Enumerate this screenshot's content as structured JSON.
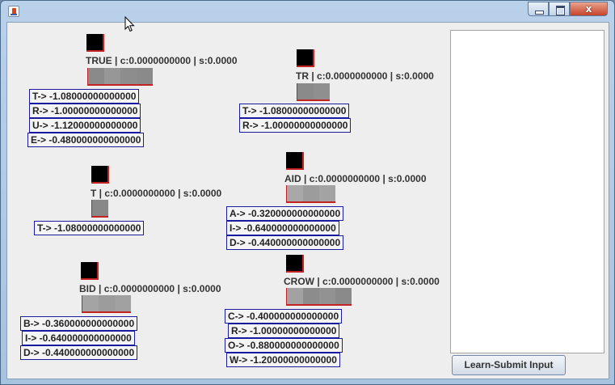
{
  "window": {
    "close_glyph": "x",
    "icon": "java-app-icon"
  },
  "nodes": [
    {
      "id": "TRUE",
      "label": "TRUE | c:0.0000000000 | s:0.0000",
      "bar": [
        "#8a8a8a",
        "#979797",
        "#8d8d8d",
        "#8a8a8a",
        "#b0b0b0"
      ],
      "weights": [
        "T->  -1.08000000000000",
        "R->  -1.00000000000000",
        "U->  -1.12000000000000",
        "E->  -0.480000000000000"
      ]
    },
    {
      "id": "TR",
      "label": "TR | c:0.0000000000 | s:0.0000",
      "bar": [
        "#8a8a8a",
        "#8f8f8f"
      ],
      "weights": [
        "T->  -1.08000000000000",
        "R->  -1.00000000000000"
      ]
    },
    {
      "id": "T",
      "label": "T | c:0.0000000000 | s:0.0000",
      "bar": [
        "#888888"
      ],
      "weights": [
        "T->  -1.08000000000000"
      ]
    },
    {
      "id": "AID",
      "label": "AID | c:0.0000000000 | s:0.0000",
      "bar": [
        "#a8a8a8",
        "#9c9c9c",
        "#a3a3a3"
      ],
      "weights": [
        "A->  -0.320000000000000",
        "I->  -0.640000000000000",
        "D->  -0.440000000000000"
      ]
    },
    {
      "id": "BID",
      "label": "BID | c:0.0000000000 | s:0.0000",
      "bar": [
        "#a4a4a4",
        "#9c9c9c",
        "#a1a1a1"
      ],
      "weights": [
        "B->  -0.360000000000000",
        "I->  -0.640000000000000",
        "D->  -0.440000000000000"
      ]
    },
    {
      "id": "CROW",
      "label": "CROW | c:0.0000000000 | s:0.0000",
      "bar": [
        "#a2a2a2",
        "#8c8c8c",
        "#929292",
        "#8a8a8a"
      ],
      "weights": [
        "C->  -0.400000000000000",
        "R->  -1.00000000000000",
        "O->  -0.880000000000000",
        "W->  -1.20000000000000"
      ]
    }
  ],
  "output_area": {
    "value": ""
  },
  "submit_button": {
    "label": "Learn-Submit Input"
  }
}
